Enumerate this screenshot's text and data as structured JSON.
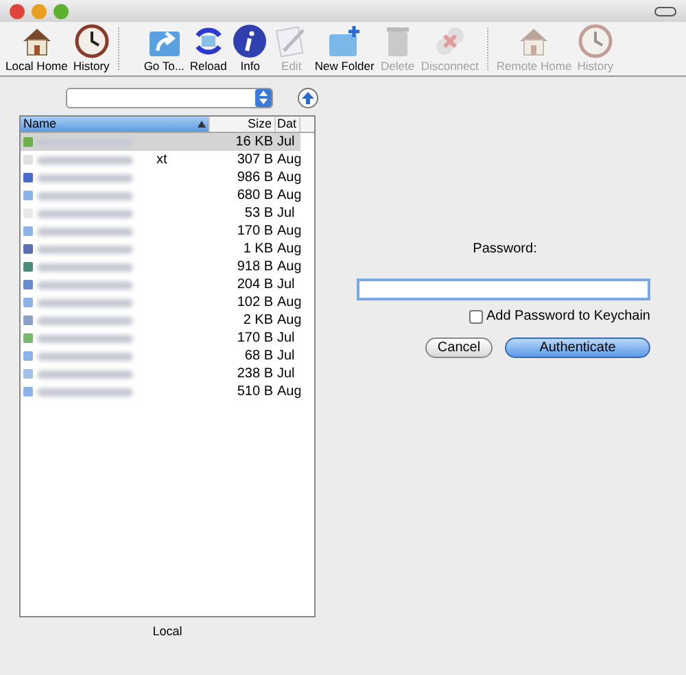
{
  "toolbar": {
    "groups": [
      [
        {
          "label": "Local Home",
          "kind": "home",
          "disabled": false
        },
        {
          "label": "History",
          "kind": "clock",
          "disabled": false
        }
      ],
      [
        {
          "label": "Go To...",
          "kind": "goto",
          "disabled": false
        },
        {
          "label": "Reload",
          "kind": "reload",
          "disabled": false
        },
        {
          "label": "Info",
          "kind": "info",
          "disabled": false
        },
        {
          "label": "Edit",
          "kind": "edit",
          "disabled": true
        },
        {
          "label": "New Folder",
          "kind": "folder",
          "disabled": false
        },
        {
          "label": "Delete",
          "kind": "trash",
          "disabled": true
        },
        {
          "label": "Disconnect",
          "kind": "disconnect",
          "disabled": true
        }
      ],
      [
        {
          "label": "Remote Home",
          "kind": "home",
          "disabled": true
        },
        {
          "label": "History",
          "kind": "clock",
          "disabled": true
        }
      ]
    ]
  },
  "local_pane": {
    "columns": [
      {
        "label": "Name",
        "selected": true
      },
      {
        "label": "Size",
        "selected": false
      },
      {
        "label": "Dat",
        "selected": false
      }
    ],
    "rows": [
      {
        "name": "",
        "size": "16 KB",
        "date": "Jul",
        "selected": true,
        "color": "#6cb04a"
      },
      {
        "name": "xt",
        "size": "307 B",
        "date": "Aug",
        "selected": false,
        "color": "#e0e0e0"
      },
      {
        "name": "",
        "size": "986 B",
        "date": "Aug",
        "selected": false,
        "color": "#4a6cc8"
      },
      {
        "name": "",
        "size": "680 B",
        "date": "Aug",
        "selected": false,
        "color": "#8ab4e8"
      },
      {
        "name": "",
        "size": "53 B",
        "date": "Jul",
        "selected": false,
        "color": "#e8e8e8"
      },
      {
        "name": "",
        "size": "170 B",
        "date": "Aug",
        "selected": false,
        "color": "#8ab4e8"
      },
      {
        "name": "",
        "size": "1 KB",
        "date": "Aug",
        "selected": false,
        "color": "#5a70b0"
      },
      {
        "name": "",
        "size": "918 B",
        "date": "Aug",
        "selected": false,
        "color": "#4a8a7a"
      },
      {
        "name": "",
        "size": "204 B",
        "date": "Jul",
        "selected": false,
        "color": "#6a8ad0"
      },
      {
        "name": "",
        "size": "102 B",
        "date": "Aug",
        "selected": false,
        "color": "#8ab4e8"
      },
      {
        "name": "",
        "size": "2 KB",
        "date": "Aug",
        "selected": false,
        "color": "#8aa0c8"
      },
      {
        "name": "",
        "size": "170 B",
        "date": "Jul",
        "selected": false,
        "color": "#7ab870"
      },
      {
        "name": "",
        "size": "68 B",
        "date": "Jul",
        "selected": false,
        "color": "#8ab4e8"
      },
      {
        "name": "",
        "size": "238 B",
        "date": "Jul",
        "selected": false,
        "color": "#a0c0e8"
      },
      {
        "name": "",
        "size": "510 B",
        "date": "Aug",
        "selected": false,
        "color": "#8ab4e8"
      }
    ],
    "footer": "Local"
  },
  "login": {
    "label": "Password:",
    "checkbox": {
      "label": "Add Password to Keychain",
      "checked": false
    },
    "buttons": [
      {
        "label": "Cancel",
        "kind": "normal"
      },
      {
        "label": "Authenticate",
        "kind": "default"
      }
    ]
  }
}
